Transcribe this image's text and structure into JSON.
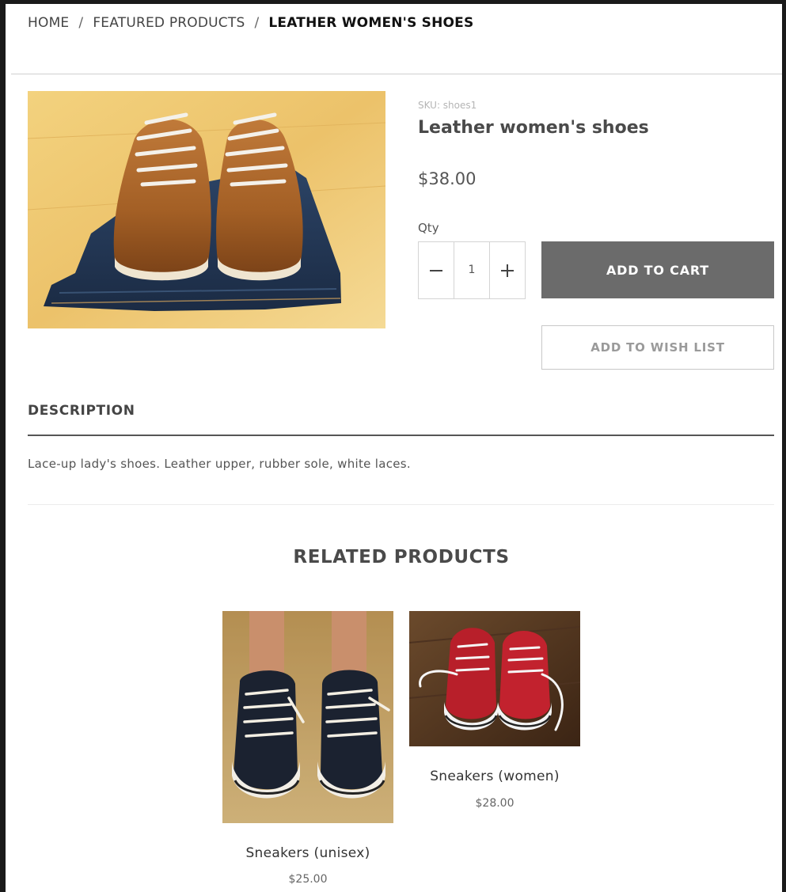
{
  "breadcrumb": {
    "home": "HOME",
    "separator": "/",
    "featured": "FEATURED PRODUCTS",
    "current": "LEATHER WOMEN'S SHOES"
  },
  "product": {
    "sku": "SKU: shoes1",
    "title": "Leather women's shoes",
    "price": "$38.00",
    "qty_label": "Qty",
    "qty_value": "1",
    "minus_icon": "minus-icon",
    "plus_icon": "plus-icon",
    "add_to_cart": "ADD TO CART",
    "add_to_wishlist": "ADD TO WISH LIST"
  },
  "description": {
    "heading": "DESCRIPTION",
    "text": "Lace-up lady's shoes. Leather upper, rubber sole, white laces."
  },
  "related": {
    "heading": "RELATED PRODUCTS",
    "items": [
      {
        "name": "Sneakers (unisex)",
        "price": "$25.00"
      },
      {
        "name": "Sneakers (women)",
        "price": "$28.00"
      }
    ]
  },
  "colors": {
    "cart_button": "#6b6b6b",
    "text_dark": "#4a4a4a"
  }
}
